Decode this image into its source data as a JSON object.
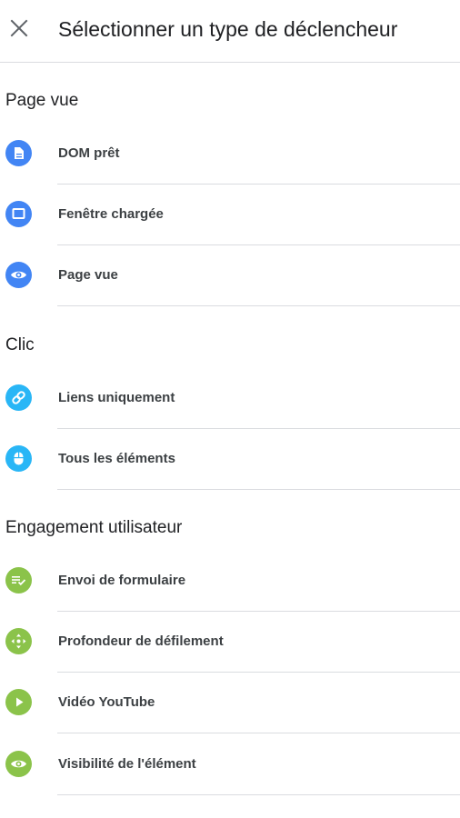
{
  "header": {
    "title": "Sélectionner un type de déclencheur",
    "close_icon": "close-icon"
  },
  "colors": {
    "page_view": "#4285f4",
    "click": "#29b6f6",
    "engagement": "#8bc34a",
    "divider": "#dadce0"
  },
  "sections": [
    {
      "title": "Page vue",
      "items": [
        {
          "label": "DOM prêt",
          "icon": "document-icon"
        },
        {
          "label": "Fenêtre chargée",
          "icon": "window-icon"
        },
        {
          "label": "Page vue",
          "icon": "eye-icon"
        }
      ]
    },
    {
      "title": "Clic",
      "items": [
        {
          "label": "Liens uniquement",
          "icon": "link-icon"
        },
        {
          "label": "Tous les éléments",
          "icon": "mouse-icon"
        }
      ]
    },
    {
      "title": "Engagement utilisateur",
      "items": [
        {
          "label": "Envoi de formulaire",
          "icon": "form-submit-icon"
        },
        {
          "label": "Profondeur de défilement",
          "icon": "scroll-icon"
        },
        {
          "label": "Vidéo YouTube",
          "icon": "play-icon"
        },
        {
          "label": "Visibilité de l'élément",
          "icon": "eye-icon"
        }
      ]
    }
  ]
}
